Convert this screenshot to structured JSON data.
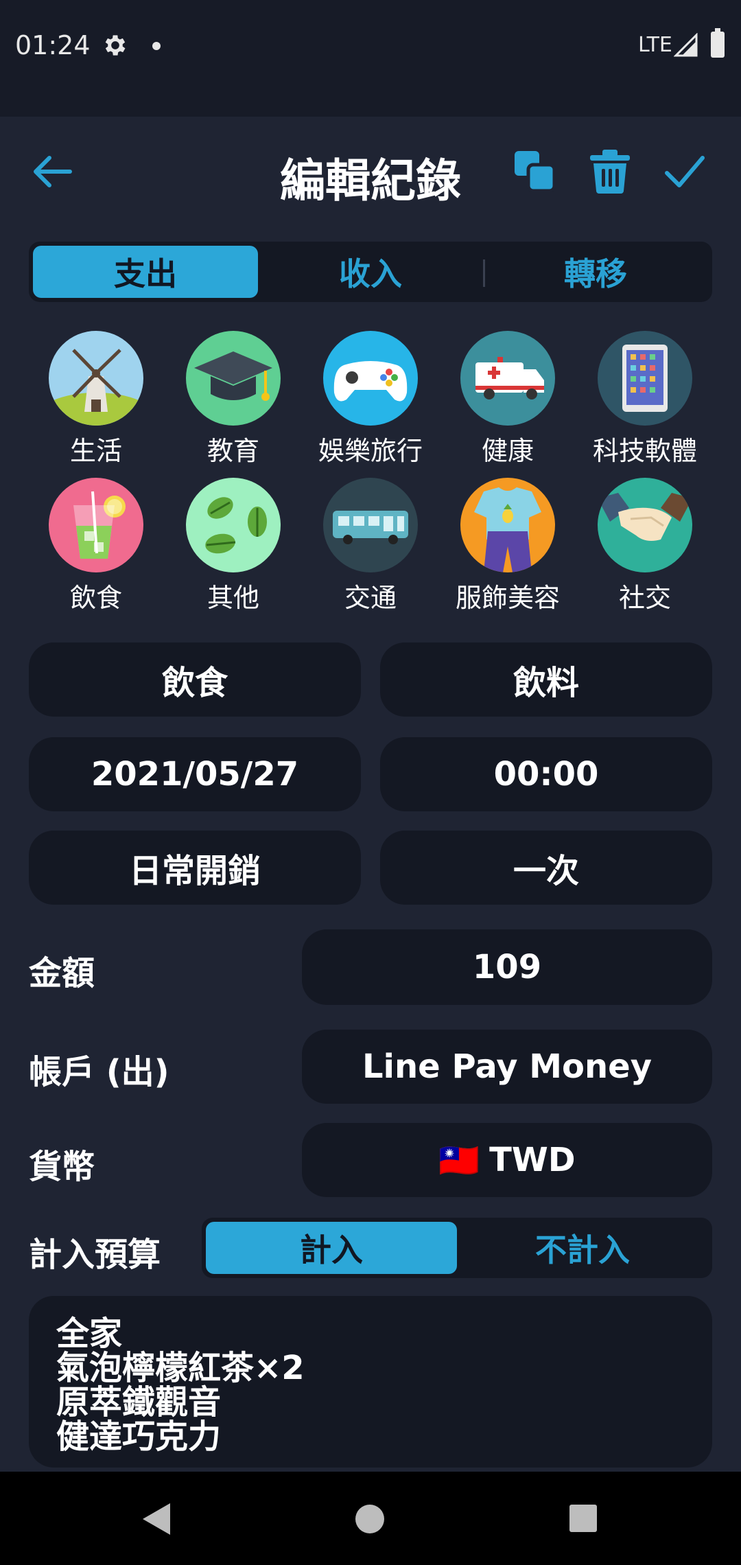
{
  "status_bar": {
    "time": "01:24",
    "network": "LTE"
  },
  "header": {
    "title": "編輯紀錄"
  },
  "type_tabs": [
    {
      "label": "支出",
      "active": true
    },
    {
      "label": "收入",
      "active": false
    },
    {
      "label": "轉移",
      "active": false
    }
  ],
  "categories": [
    {
      "label": "生活",
      "icon": "windmill-icon"
    },
    {
      "label": "教育",
      "icon": "graduation-cap-icon"
    },
    {
      "label": "娛樂旅行",
      "icon": "game-controller-icon"
    },
    {
      "label": "健康",
      "icon": "ambulance-icon"
    },
    {
      "label": "科技軟體",
      "icon": "tablet-icon"
    },
    {
      "label": "飲食",
      "icon": "drink-icon"
    },
    {
      "label": "其他",
      "icon": "leaves-icon"
    },
    {
      "label": "交通",
      "icon": "bus-icon"
    },
    {
      "label": "服飾美容",
      "icon": "clothing-icon"
    },
    {
      "label": "社交",
      "icon": "handshake-icon"
    }
  ],
  "form": {
    "category": "飲食",
    "subcategory": "飲料",
    "date": "2021/05/27",
    "time": "00:00",
    "expense_type": "日常開銷",
    "recurrence": "一次",
    "amount_label": "金額",
    "amount": "109",
    "account_label": "帳戶 (出)",
    "account": "Line Pay Money",
    "currency_label": "貨幣",
    "currency": "TWD",
    "currency_flag": "🇹🇼",
    "budget_label": "計入預算",
    "budget_options": [
      {
        "label": "計入",
        "active": true
      },
      {
        "label": "不計入",
        "active": false
      }
    ]
  },
  "notes": [
    "全家",
    "氣泡檸檬紅茶×2",
    "原萃鐵觀音",
    "健達巧克力"
  ],
  "colors": {
    "background": "#1f2433",
    "card": "#141823",
    "accent": "#2ca7d8"
  }
}
